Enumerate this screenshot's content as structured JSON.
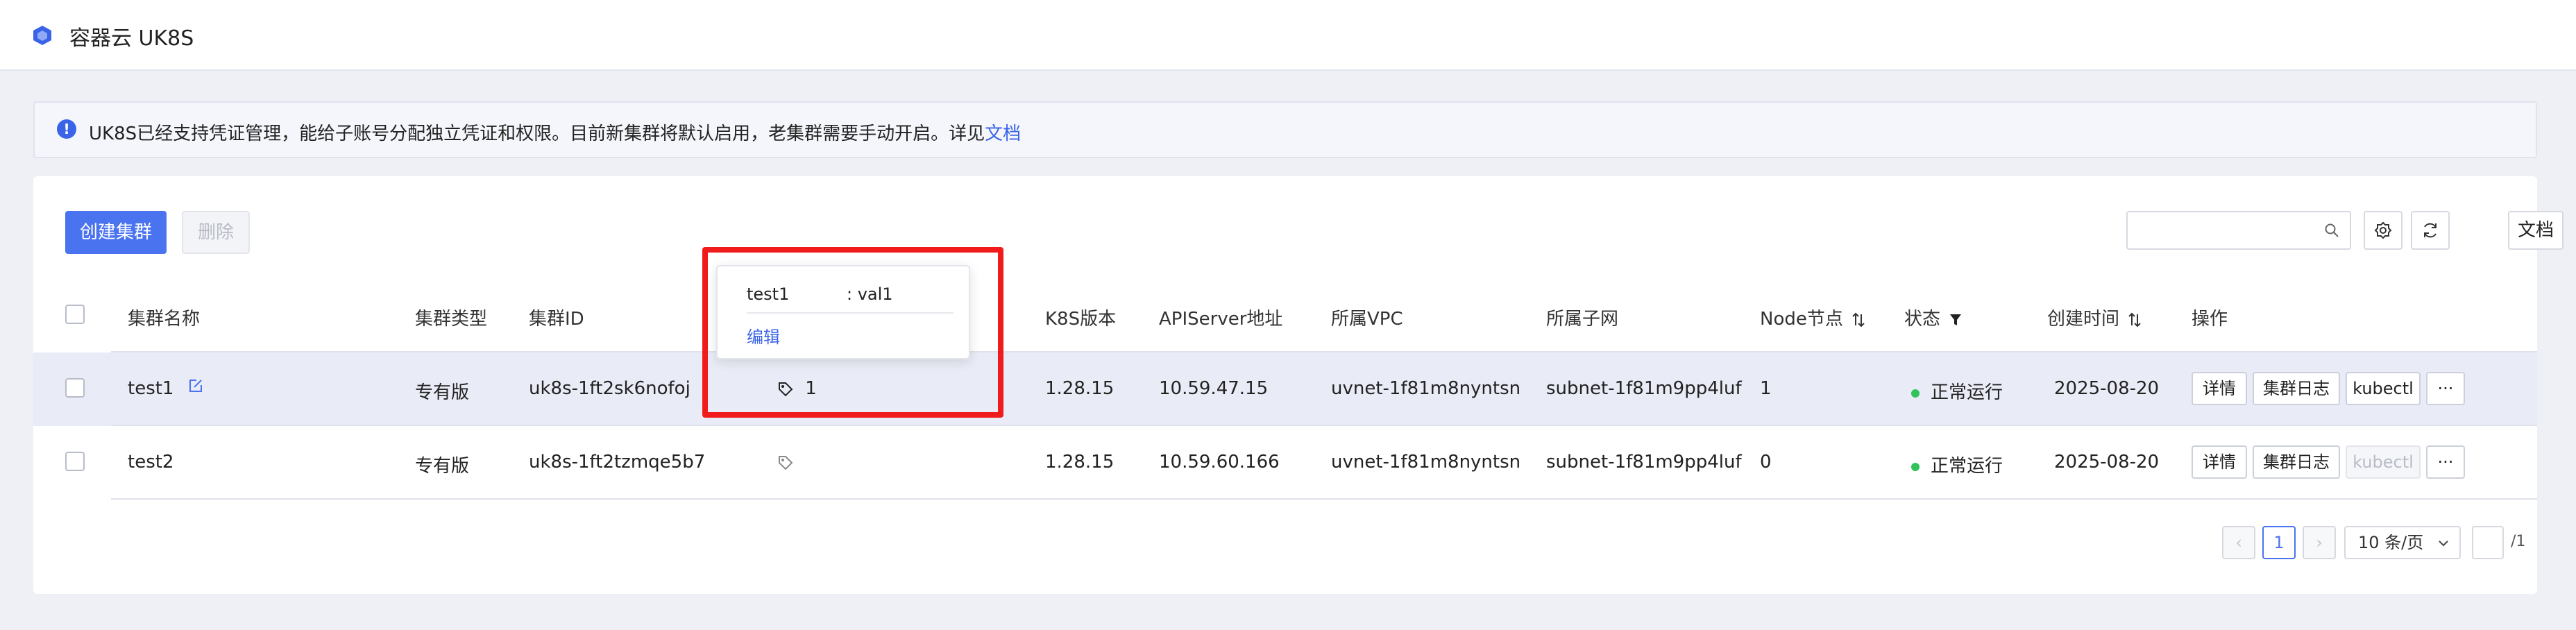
{
  "header": {
    "title": "容器云 UK8S"
  },
  "notice": {
    "text": "UK8S已经支持凭证管理，能给子账号分配独立凭证和权限。目前新集群将默认启用，老集群需要手动开启。详见",
    "link": "文档"
  },
  "toolbar": {
    "create_label": "创建集群",
    "delete_label": "删除",
    "search_placeholder": "",
    "doc_label": "文档"
  },
  "table": {
    "columns": [
      "集群名称",
      "集群类型",
      "集群ID",
      "K8S版本",
      "APIServer地址",
      "所属VPC",
      "所属子网",
      "Node节点",
      "状态",
      "创建时间",
      "操作"
    ],
    "rows": [
      {
        "name": "test1",
        "type": "专有版",
        "id": "uk8s-1ft2sk6nofoj",
        "tag_count": "1",
        "version": "1.28.15",
        "apiserver": "10.59.47.15",
        "vpc": "uvnet-1f81m8nyntsn",
        "subnet": "subnet-1f81m9pp4luf",
        "nodes": "1",
        "status": "正常运行",
        "created": "2025-08-20",
        "kubectl_enabled": true
      },
      {
        "name": "test2",
        "type": "专有版",
        "id": "uk8s-1ft2tzmqe5b7",
        "tag_count": "",
        "version": "1.28.15",
        "apiserver": "10.59.60.166",
        "vpc": "uvnet-1f81m8nyntsn",
        "subnet": "subnet-1f81m9pp4luf",
        "nodes": "0",
        "status": "正常运行",
        "created": "2025-08-20",
        "kubectl_enabled": false
      }
    ],
    "actions": {
      "detail": "详情",
      "logs": "集群日志",
      "kubectl": "kubectl",
      "more": "···"
    }
  },
  "tag_popover": {
    "key": "test1",
    "value": ": val1",
    "edit_label": "编辑"
  },
  "pagination": {
    "prev": "‹",
    "current_page": "1",
    "next": "›",
    "page_size_label": "10 条/页",
    "total_label": "/1"
  },
  "colors": {
    "primary": "#4a73ef",
    "link": "#3a63e8",
    "status_ok": "#2fc35a",
    "highlight": "#f01c1c"
  }
}
